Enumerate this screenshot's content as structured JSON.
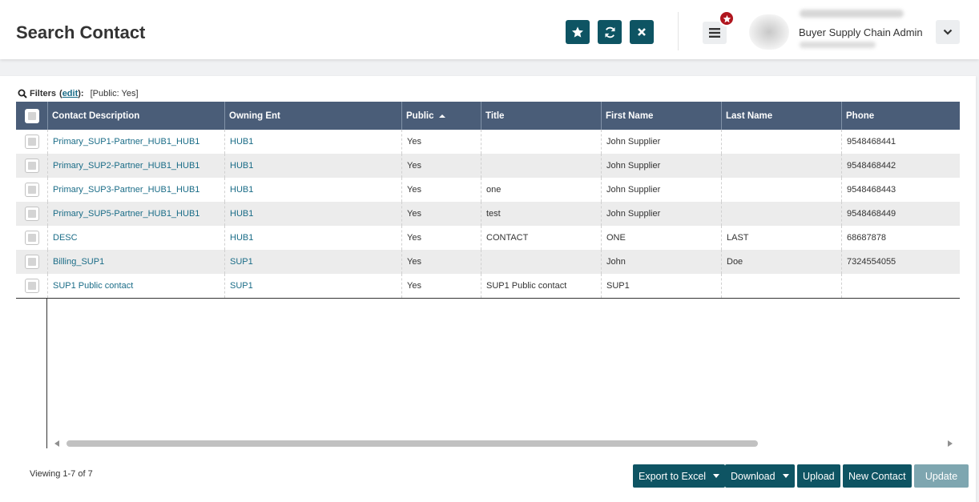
{
  "header": {
    "title": "Search Contact",
    "user_role": "Buyer Supply Chain Admin",
    "icons": {
      "favorite": "star-icon",
      "refresh": "refresh-icon",
      "close": "close-icon",
      "menu": "hamburger-menu-icon",
      "notification": "star-badge-icon",
      "user_menu": "chevron-down-icon"
    },
    "accent_color": "#0e5463",
    "badge_color": "#b0161e"
  },
  "filters": {
    "label": "Filters",
    "open_paren": "(",
    "edit_link": "edit",
    "close_paren": "):",
    "active": "[Public: Yes]"
  },
  "table": {
    "header_color": "#4a5d78",
    "columns": [
      "Contact Description",
      "Owning Ent",
      "Public",
      "Title",
      "First Name",
      "Last Name",
      "Phone"
    ],
    "sorted_column": "Public",
    "sort_direction": "ascending",
    "rows": [
      {
        "description": "Primary_SUP1-Partner_HUB1_HUB1",
        "owning_ent": "HUB1",
        "public": "Yes",
        "title": "",
        "first_name": "John Supplier",
        "last_name": "",
        "phone": "9548468441"
      },
      {
        "description": "Primary_SUP2-Partner_HUB1_HUB1",
        "owning_ent": "HUB1",
        "public": "Yes",
        "title": "",
        "first_name": "John Supplier",
        "last_name": "",
        "phone": "9548468442"
      },
      {
        "description": "Primary_SUP3-Partner_HUB1_HUB1",
        "owning_ent": "HUB1",
        "public": "Yes",
        "title": "one",
        "first_name": "John Supplier",
        "last_name": "",
        "phone": "9548468443"
      },
      {
        "description": "Primary_SUP5-Partner_HUB1_HUB1",
        "owning_ent": "HUB1",
        "public": "Yes",
        "title": "test",
        "first_name": "John Supplier",
        "last_name": "",
        "phone": "9548468449"
      },
      {
        "description": "DESC",
        "owning_ent": "HUB1",
        "public": "Yes",
        "title": "CONTACT",
        "first_name": "ONE",
        "last_name": "LAST",
        "phone": "68687878"
      },
      {
        "description": "Billing_SUP1",
        "owning_ent": "SUP1",
        "public": "Yes",
        "title": "",
        "first_name": "John",
        "last_name": "Doe",
        "phone": "7324554055"
      },
      {
        "description": "SUP1 Public contact",
        "owning_ent": "SUP1",
        "public": "Yes",
        "title": "SUP1 Public contact",
        "first_name": "SUP1",
        "last_name": "",
        "phone": ""
      }
    ]
  },
  "footer": {
    "viewing": "Viewing 1-7 of 7",
    "buttons": {
      "export": "Export to Excel",
      "download": "Download",
      "upload": "Upload",
      "new_contact": "New Contact",
      "update": "Update"
    }
  }
}
